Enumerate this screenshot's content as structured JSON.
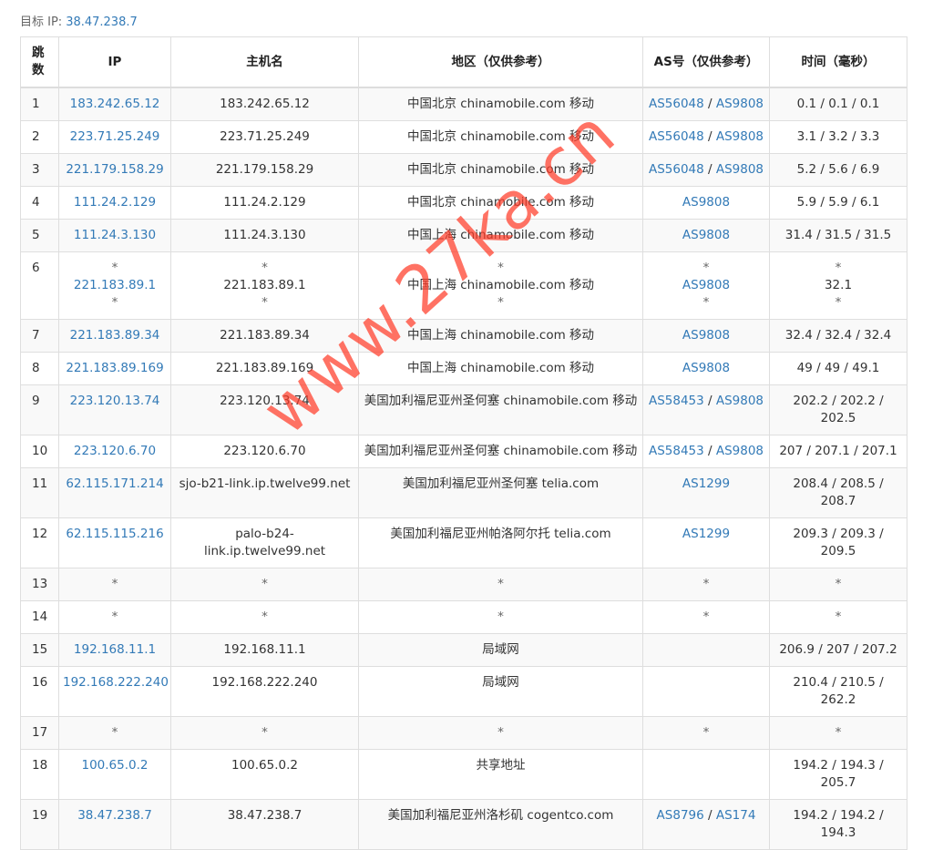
{
  "target": {
    "label": "目标 IP:",
    "ip": "38.47.238.7"
  },
  "table": {
    "headers": {
      "hop": "跳\n数",
      "ip": "IP",
      "host": "主机名",
      "region": "地区（仅供参考）",
      "as": "AS号（仅供参考）",
      "time": "时间（毫秒）"
    },
    "rows": [
      {
        "hop": "1",
        "ip": [
          "183.242.65.12"
        ],
        "host": [
          "183.242.65.12"
        ],
        "region": [
          "中国北京 chinamobile.com 移动"
        ],
        "as": [
          [
            "AS56048",
            "AS9808"
          ]
        ],
        "time": [
          "0.1 / 0.1 / 0.1"
        ]
      },
      {
        "hop": "2",
        "ip": [
          "223.71.25.249"
        ],
        "host": [
          "223.71.25.249"
        ],
        "region": [
          "中国北京 chinamobile.com 移动"
        ],
        "as": [
          [
            "AS56048",
            "AS9808"
          ]
        ],
        "time": [
          "3.1 / 3.2 / 3.3"
        ]
      },
      {
        "hop": "3",
        "ip": [
          "221.179.158.29"
        ],
        "host": [
          "221.179.158.29"
        ],
        "region": [
          "中国北京 chinamobile.com 移动"
        ],
        "as": [
          [
            "AS56048",
            "AS9808"
          ]
        ],
        "time": [
          "5.2 / 5.6 / 6.9"
        ]
      },
      {
        "hop": "4",
        "ip": [
          "111.24.2.129"
        ],
        "host": [
          "111.24.2.129"
        ],
        "region": [
          "中国北京 chinamobile.com 移动"
        ],
        "as": [
          [
            "AS9808"
          ]
        ],
        "time": [
          "5.9 / 5.9 / 6.1"
        ]
      },
      {
        "hop": "5",
        "ip": [
          "111.24.3.130"
        ],
        "host": [
          "111.24.3.130"
        ],
        "region": [
          "中国上海 chinamobile.com 移动"
        ],
        "as": [
          [
            "AS9808"
          ]
        ],
        "time": [
          "31.4 / 31.5 / 31.5"
        ]
      },
      {
        "hop": "6",
        "ip": [
          "*",
          "221.183.89.1",
          "*"
        ],
        "host": [
          "*",
          "221.183.89.1",
          "*"
        ],
        "region": [
          "*",
          "中国上海 chinamobile.com 移动",
          "*"
        ],
        "as": [
          [
            "*"
          ],
          [
            "AS9808"
          ],
          [
            "*"
          ]
        ],
        "time": [
          "*",
          "32.1",
          "*"
        ]
      },
      {
        "hop": "7",
        "ip": [
          "221.183.89.34"
        ],
        "host": [
          "221.183.89.34"
        ],
        "region": [
          "中国上海 chinamobile.com 移动"
        ],
        "as": [
          [
            "AS9808"
          ]
        ],
        "time": [
          "32.4 / 32.4 / 32.4"
        ]
      },
      {
        "hop": "8",
        "ip": [
          "221.183.89.169"
        ],
        "host": [
          "221.183.89.169"
        ],
        "region": [
          "中国上海 chinamobile.com 移动"
        ],
        "as": [
          [
            "AS9808"
          ]
        ],
        "time": [
          "49 / 49 / 49.1"
        ]
      },
      {
        "hop": "9",
        "ip": [
          "223.120.13.74"
        ],
        "host": [
          "223.120.13.74"
        ],
        "region": [
          "美国加利福尼亚州圣何塞 chinamobile.com 移动"
        ],
        "as": [
          [
            "AS58453",
            "AS9808"
          ]
        ],
        "time": [
          "202.2 / 202.2 / 202.5"
        ]
      },
      {
        "hop": "10",
        "ip": [
          "223.120.6.70"
        ],
        "host": [
          "223.120.6.70"
        ],
        "region": [
          "美国加利福尼亚州圣何塞 chinamobile.com 移动"
        ],
        "as": [
          [
            "AS58453",
            "AS9808"
          ]
        ],
        "time": [
          "207 / 207.1 / 207.1"
        ]
      },
      {
        "hop": "11",
        "ip": [
          "62.115.171.214"
        ],
        "host": [
          "sjo-b21-link.ip.twelve99.net"
        ],
        "region": [
          "美国加利福尼亚州圣何塞 telia.com"
        ],
        "as": [
          [
            "AS1299"
          ]
        ],
        "time": [
          "208.4 / 208.5 / 208.7"
        ]
      },
      {
        "hop": "12",
        "ip": [
          "62.115.115.216"
        ],
        "host": [
          "palo-b24-link.ip.twelve99.net"
        ],
        "region": [
          "美国加利福尼亚州帕洛阿尔托 telia.com"
        ],
        "as": [
          [
            "AS1299"
          ]
        ],
        "time": [
          "209.3 / 209.3 / 209.5"
        ]
      },
      {
        "hop": "13",
        "ip": [
          "*"
        ],
        "host": [
          "*"
        ],
        "region": [
          "*"
        ],
        "as": [
          [
            "*"
          ]
        ],
        "time": [
          "*"
        ]
      },
      {
        "hop": "14",
        "ip": [
          "*"
        ],
        "host": [
          "*"
        ],
        "region": [
          "*"
        ],
        "as": [
          [
            "*"
          ]
        ],
        "time": [
          "*"
        ]
      },
      {
        "hop": "15",
        "ip": [
          "192.168.11.1"
        ],
        "host": [
          "192.168.11.1"
        ],
        "region": [
          "局域网"
        ],
        "as": [],
        "time": [
          "206.9 / 207 / 207.2"
        ]
      },
      {
        "hop": "16",
        "ip": [
          "192.168.222.240"
        ],
        "host": [
          "192.168.222.240"
        ],
        "region": [
          "局域网"
        ],
        "as": [],
        "time": [
          "210.4 / 210.5 / 262.2"
        ]
      },
      {
        "hop": "17",
        "ip": [
          "*"
        ],
        "host": [
          "*"
        ],
        "region": [
          "*"
        ],
        "as": [
          [
            "*"
          ]
        ],
        "time": [
          "*"
        ]
      },
      {
        "hop": "18",
        "ip": [
          "100.65.0.2"
        ],
        "host": [
          "100.65.0.2"
        ],
        "region": [
          "共享地址"
        ],
        "as": [],
        "time": [
          "194.2 / 194.3 / 205.7"
        ]
      },
      {
        "hop": "19",
        "ip": [
          "38.47.238.7"
        ],
        "host": [
          "38.47.238.7"
        ],
        "region": [
          "美国加利福尼亚州洛杉矶 cogentco.com"
        ],
        "as": [
          [
            "AS8796",
            "AS174"
          ]
        ],
        "time": [
          "194.2 / 194.2 / 194.3"
        ]
      }
    ]
  },
  "watermark": "www.27ka.cn",
  "colors": {
    "link": "#337ab7",
    "watermark": "#ff3c28",
    "row_alt": "#f9f9f9",
    "border": "#dedede"
  }
}
